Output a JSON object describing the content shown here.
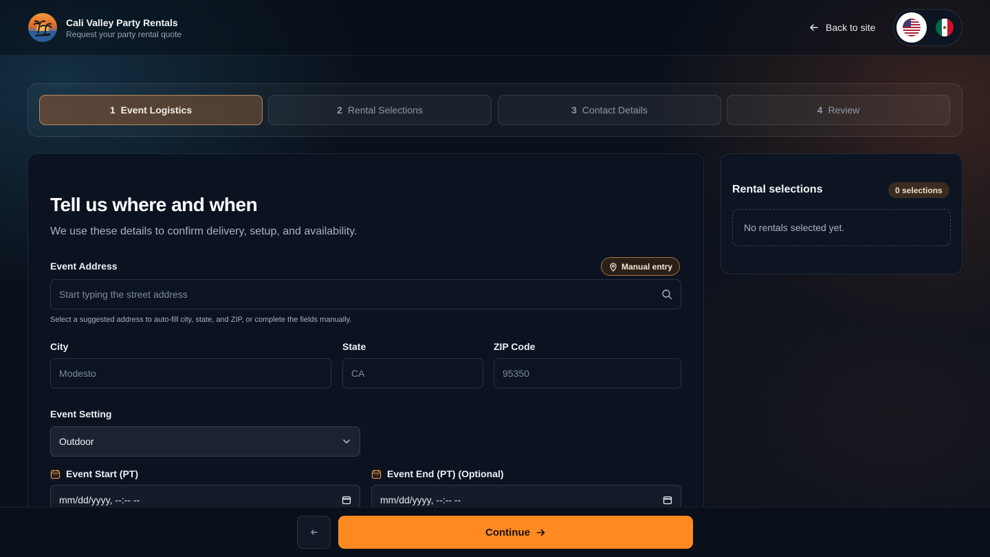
{
  "header": {
    "brand_title": "Cali Valley Party Rentals",
    "brand_subtitle": "Request your party rental quote",
    "back_label": "Back to site",
    "languages": [
      {
        "code": "en-US",
        "icon": "us-flag-icon",
        "active": true
      },
      {
        "code": "es-MX",
        "icon": "mexico-flag-icon",
        "active": false
      }
    ]
  },
  "steps": [
    {
      "num": "1",
      "label": "Event Logistics",
      "active": true
    },
    {
      "num": "2",
      "label": "Rental Selections",
      "active": false
    },
    {
      "num": "3",
      "label": "Contact Details",
      "active": false
    },
    {
      "num": "4",
      "label": "Review",
      "active": false
    }
  ],
  "form": {
    "title": "Tell us where and when",
    "subtitle": "We use these details to confirm delivery, setup, and availability.",
    "address": {
      "label": "Event Address",
      "manual_label": "Manual entry",
      "placeholder": "Start typing the street address",
      "help": "Select a suggested address to auto-fill city, state, and ZIP, or complete the fields manually."
    },
    "city": {
      "label": "City",
      "placeholder": "Modesto"
    },
    "state": {
      "label": "State",
      "placeholder": "CA"
    },
    "zip": {
      "label": "ZIP Code",
      "placeholder": "95350"
    },
    "setting": {
      "label": "Event Setting",
      "value": "Outdoor"
    },
    "start": {
      "label": "Event Start (PT)",
      "value": "mm/dd/yyyy, --:-- --"
    },
    "end": {
      "label": "Event End (PT) (Optional)",
      "value": "mm/dd/yyyy, --:-- --"
    }
  },
  "sidebar": {
    "title": "Rental selections",
    "count_label": "0 selections",
    "empty_text": "No rentals selected yet."
  },
  "footer": {
    "continue_label": "Continue"
  },
  "colors": {
    "accent": "#ff8a22",
    "active_step": "#5b4638",
    "background": "#0b111b"
  }
}
